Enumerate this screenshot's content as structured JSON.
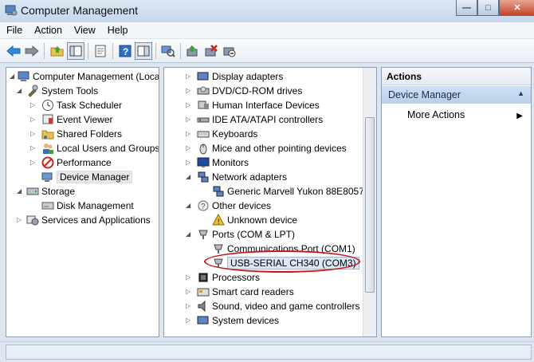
{
  "window": {
    "title": "Computer Management"
  },
  "menu": {
    "file": "File",
    "action": "Action",
    "view": "View",
    "help": "Help"
  },
  "left_tree": {
    "root": "Computer Management (Local",
    "system_tools": "System Tools",
    "task_scheduler": "Task Scheduler",
    "event_viewer": "Event Viewer",
    "shared_folders": "Shared Folders",
    "local_users": "Local Users and Groups",
    "performance": "Performance",
    "device_manager": "Device Manager",
    "storage": "Storage",
    "disk_management": "Disk Management",
    "services": "Services and Applications"
  },
  "devices": {
    "display": "Display adapters",
    "dvd": "DVD/CD-ROM drives",
    "hid": "Human Interface Devices",
    "ide": "IDE ATA/ATAPI controllers",
    "keyboards": "Keyboards",
    "mice": "Mice and other pointing devices",
    "monitors": "Monitors",
    "network": "Network adapters",
    "marvell": "Generic Marvell Yukon 88E8057 P",
    "other": "Other devices",
    "unknown": "Unknown device",
    "ports": "Ports (COM & LPT)",
    "com1": "Communications Port (COM1)",
    "ch340": "USB-SERIAL CH340 (COM3)",
    "processors": "Processors",
    "smartcard": "Smart card readers",
    "sound": "Sound, video and game controllers",
    "system": "System devices"
  },
  "actions": {
    "header": "Actions",
    "device_manager": "Device Manager",
    "more_actions": "More Actions"
  },
  "colors": {
    "highlight_oval": "#c01a1a",
    "actions_selected": "#c4d8ef"
  }
}
